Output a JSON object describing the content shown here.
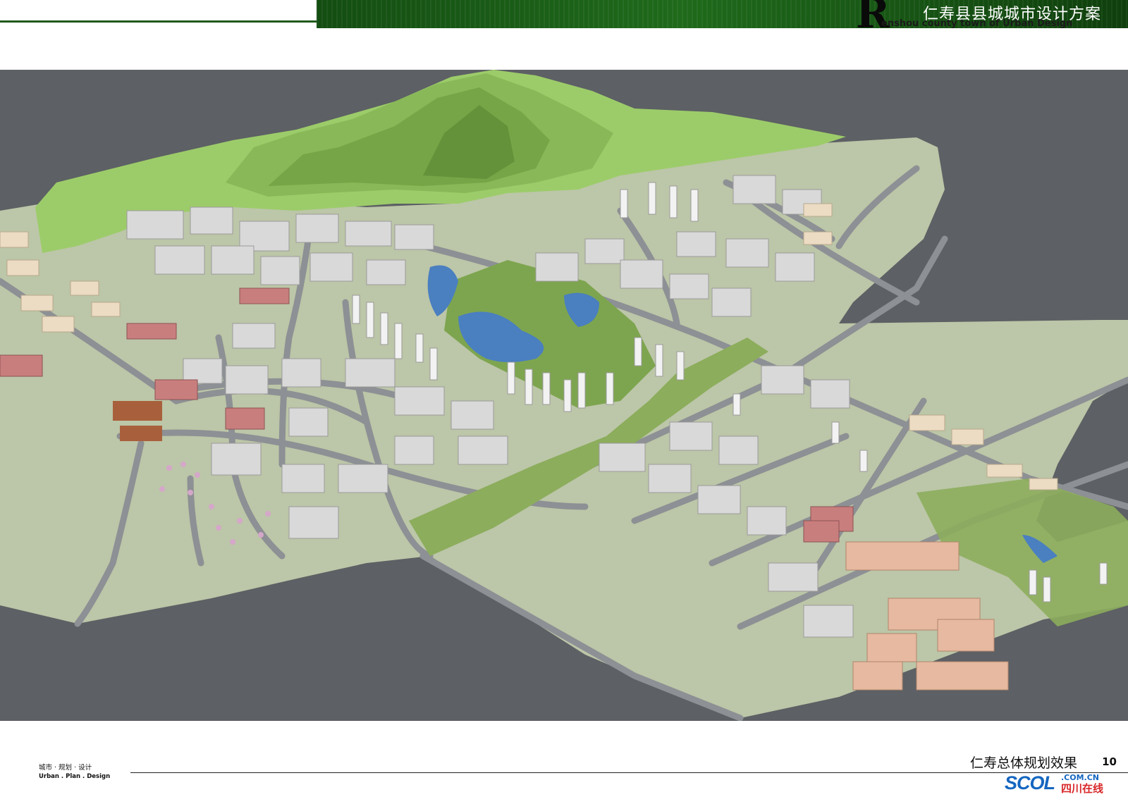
{
  "header": {
    "title": "仁寿县县城城市设计方案",
    "logo_letter": "R",
    "subtitle": "enshou county town of Urban Design"
  },
  "footer": {
    "left_cn": "城市 · 规划 · 设计",
    "left_en": "Urban . Plan . Design",
    "caption": "仁寿总体规划效果",
    "page_number": "10"
  },
  "watermark": {
    "brand": "SC",
    "brand_o": "O",
    "brand_l": "L",
    "domain": ".COM.CN",
    "cn_name": "四川在线"
  },
  "colors": {
    "header_green": "#1f6a1b",
    "ground": "#5d6064",
    "terrain": "#bcc6a8",
    "road": "#8d9094",
    "mountain": "#9ccc6a",
    "water": "#4a7fc0",
    "greenbelt": "#8cad5c"
  }
}
